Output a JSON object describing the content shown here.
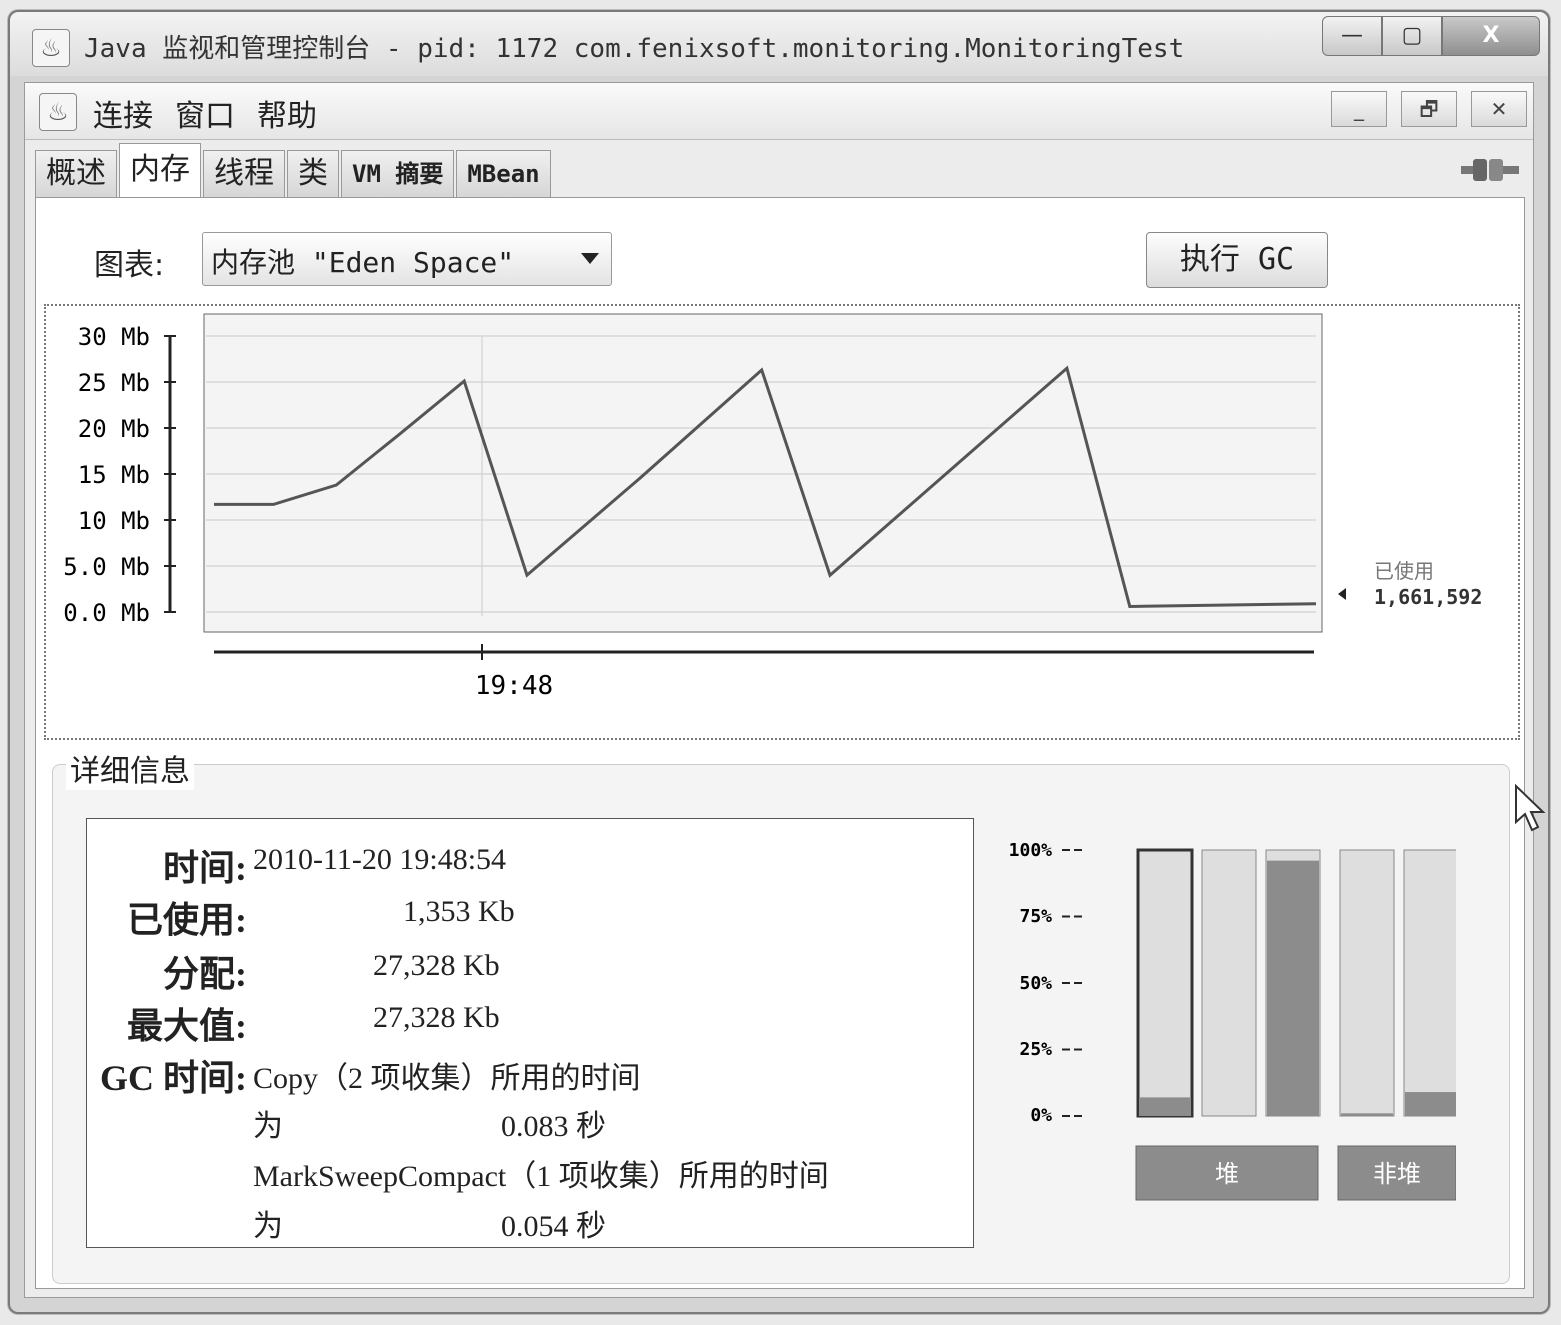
{
  "window": {
    "title": "Java 监视和管理控制台 - pid: 1172 com.fenixsoft.monitoring.MonitoringTest",
    "controls": {
      "minimize": "—",
      "maximize": "▢",
      "close": "X"
    }
  },
  "menubar": {
    "items": [
      "连接",
      "窗口",
      "帮助"
    ],
    "mdi_controls": {
      "minimize": "_",
      "restore": "🗗",
      "close": "✕"
    }
  },
  "tabs": [
    "概述",
    "内存",
    "线程",
    "类",
    "VM 摘要",
    "MBean"
  ],
  "active_tab": "内存",
  "icons": {
    "app": "java-cup-icon",
    "connection": "plug-icon"
  },
  "toolbar": {
    "chart_label": "图表:",
    "chart_select_value": "内存池 \"Eden Space\"",
    "gc_button": "执行 GC"
  },
  "chart_data": {
    "type": "line",
    "y_ticks": [
      "30 Mb",
      "25 Mb",
      "20 Mb",
      "15 Mb",
      "10 Mb",
      "5.0 Mb",
      "0.0 Mb"
    ],
    "ylim": [
      0,
      30
    ],
    "ylabel": "",
    "xlabel": "",
    "x_tick_label": "19:48",
    "series": [
      {
        "points_mb": [
          11.7,
          11.7,
          13.8,
          19.2,
          25.1,
          4.0,
          14.6,
          26.3,
          4.0,
          26.5,
          0.6,
          0.9
        ],
        "points_t": [
          0,
          0.054,
          0.111,
          0.167,
          0.227,
          0.284,
          0.387,
          0.497,
          0.559,
          0.774,
          0.831,
          1.0
        ]
      }
    ],
    "legend": {
      "label": "已使用",
      "value": "1,661,592"
    },
    "line_color": "#555555",
    "grid": true
  },
  "details": {
    "title": "详细信息",
    "time_label": "时间:",
    "time_value": "2010-11-20 19:48:54",
    "used_label": "已使用:",
    "used_value": "1,353 Kb",
    "committed_label": "分配:",
    "committed_value": "27,328 Kb",
    "max_label": "最大值:",
    "max_value": "27,328 Kb",
    "gc_label": "GC 时间:",
    "gc_line1": "Copy（2 项收集）所用的时间",
    "gc_line2_prefix": "为",
    "gc_line2_value": "0.083 秒",
    "gc_line3": "MarkSweepCompact（1 项收集）所用的时间",
    "gc_line4_prefix": "为",
    "gc_line4_value": "0.054 秒"
  },
  "pool_bars": {
    "y_ticks": [
      "100%",
      "75%",
      "50%",
      "25%",
      "0%"
    ],
    "heap_bars": [
      0.07,
      0.0,
      0.96
    ],
    "nonheap_bars": [
      0.01,
      0.09
    ],
    "heap_label": "堆",
    "nonheap_label": "非堆",
    "fill_color": "#8c8c8c",
    "bg_color": "#dedede"
  }
}
